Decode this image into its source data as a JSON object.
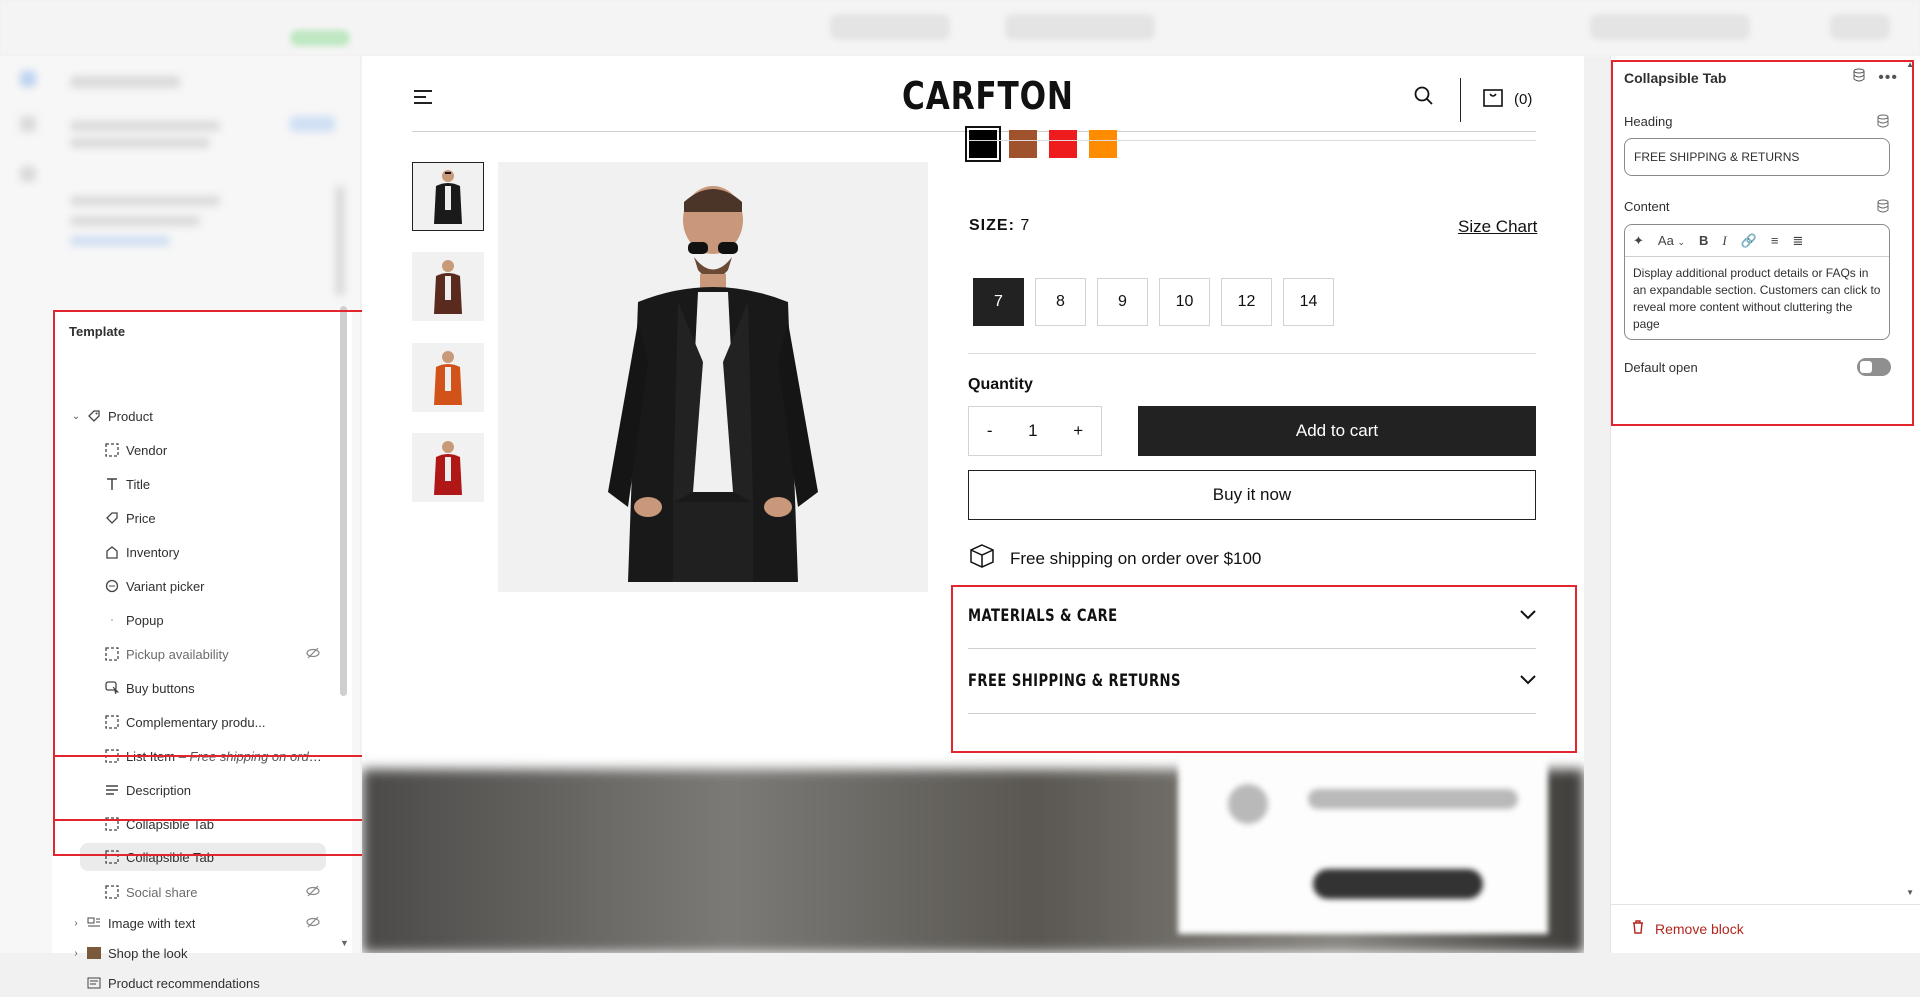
{
  "template": {
    "title": "Template",
    "items": [
      {
        "label": "Product",
        "icon": "tag-icon"
      },
      {
        "label": "Vendor",
        "icon": "block-icon"
      },
      {
        "label": "Title",
        "icon": "text-icon"
      },
      {
        "label": "Price",
        "icon": "price-tag-icon"
      },
      {
        "label": "Inventory",
        "icon": "inventory-icon"
      },
      {
        "label": "Variant picker",
        "icon": "variant-icon"
      },
      {
        "label": "Popup",
        "icon": "popup-icon"
      },
      {
        "label": "Pickup availability",
        "icon": "block-icon"
      },
      {
        "label": "Buy buttons",
        "icon": "cursor-icon"
      },
      {
        "label": "Complementary produ...",
        "icon": "block-icon"
      },
      {
        "label": "List Item",
        "sub": "– Free shipping on orde...",
        "icon": "block-icon"
      },
      {
        "label": "Description",
        "icon": "paragraph-icon"
      },
      {
        "label": "Collapsible Tab",
        "icon": "block-icon"
      },
      {
        "label": "Collapsible Tab",
        "icon": "block-icon"
      },
      {
        "label": "Social share",
        "icon": "block-icon"
      },
      {
        "label": "Image with text",
        "icon": "image-text-icon"
      },
      {
        "label": "Shop the look",
        "icon": "image-thumb-icon"
      },
      {
        "label": "Product recommendations",
        "icon": "product-icon"
      }
    ]
  },
  "store": {
    "logo": "CARFTON",
    "cart_count": "(0)"
  },
  "product": {
    "colors": [
      "#000000",
      "#a0522d",
      "#ee1c1c",
      "#ff8c00"
    ],
    "size_label": "SIZE:",
    "size_value": "7",
    "size_chart": "Size Chart",
    "sizes": [
      "7",
      "8",
      "9",
      "10",
      "12",
      "14"
    ],
    "quantity_label": "Quantity",
    "qty_minus": "-",
    "qty_value": "1",
    "qty_plus": "+",
    "add_to_cart": "Add to cart",
    "buy_now": "Buy it now",
    "shipping": "Free shipping on order over $100",
    "tabs": [
      "MATERIALS & CARE",
      "FREE SHIPPING & RETURNS"
    ],
    "thumbnails": [
      "black jacket",
      "brown jacket",
      "orange jacket",
      "red jacket"
    ]
  },
  "panel": {
    "title": "Collapsible Tab",
    "heading_label": "Heading",
    "heading_value": "FREE SHIPPING & RETURNS",
    "content_label": "Content",
    "content_text": "Display additional product details or FAQs in an expandable section. Customers can click to reveal more content without cluttering the page",
    "toolbar_font": "Aa",
    "default_open_label": "Default open",
    "default_open": false,
    "remove_label": "Remove block"
  }
}
